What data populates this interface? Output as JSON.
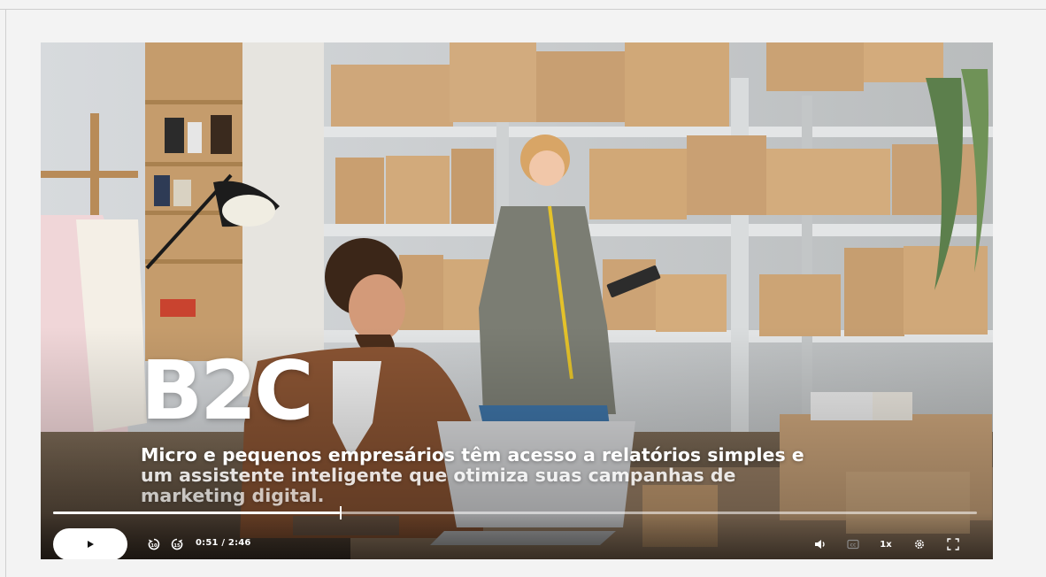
{
  "video": {
    "overlay_title": "B2C",
    "overlay_subtitle_lines": [
      "Micro e pequenos empresários têm acesso a relatórios simples e",
      "um assistente inteligente que otimiza suas campanhas de",
      "marketing digital."
    ]
  },
  "player": {
    "current_time": "0:51",
    "time_separator": " / ",
    "duration": "2:46",
    "progress_fraction": 0.31,
    "playback_speed": "1x",
    "icons": {
      "play": "play-icon",
      "rewind": "rewind-10-icon",
      "forward": "forward-15-icon",
      "volume": "volume-icon",
      "captions": "captions-icon",
      "settings": "gear-icon",
      "fullscreen": "fullscreen-icon"
    }
  },
  "colors": {
    "player_bg": "#1b1c1e",
    "control_fg": "#ffffff",
    "page_bg": "#f3f3f3"
  }
}
